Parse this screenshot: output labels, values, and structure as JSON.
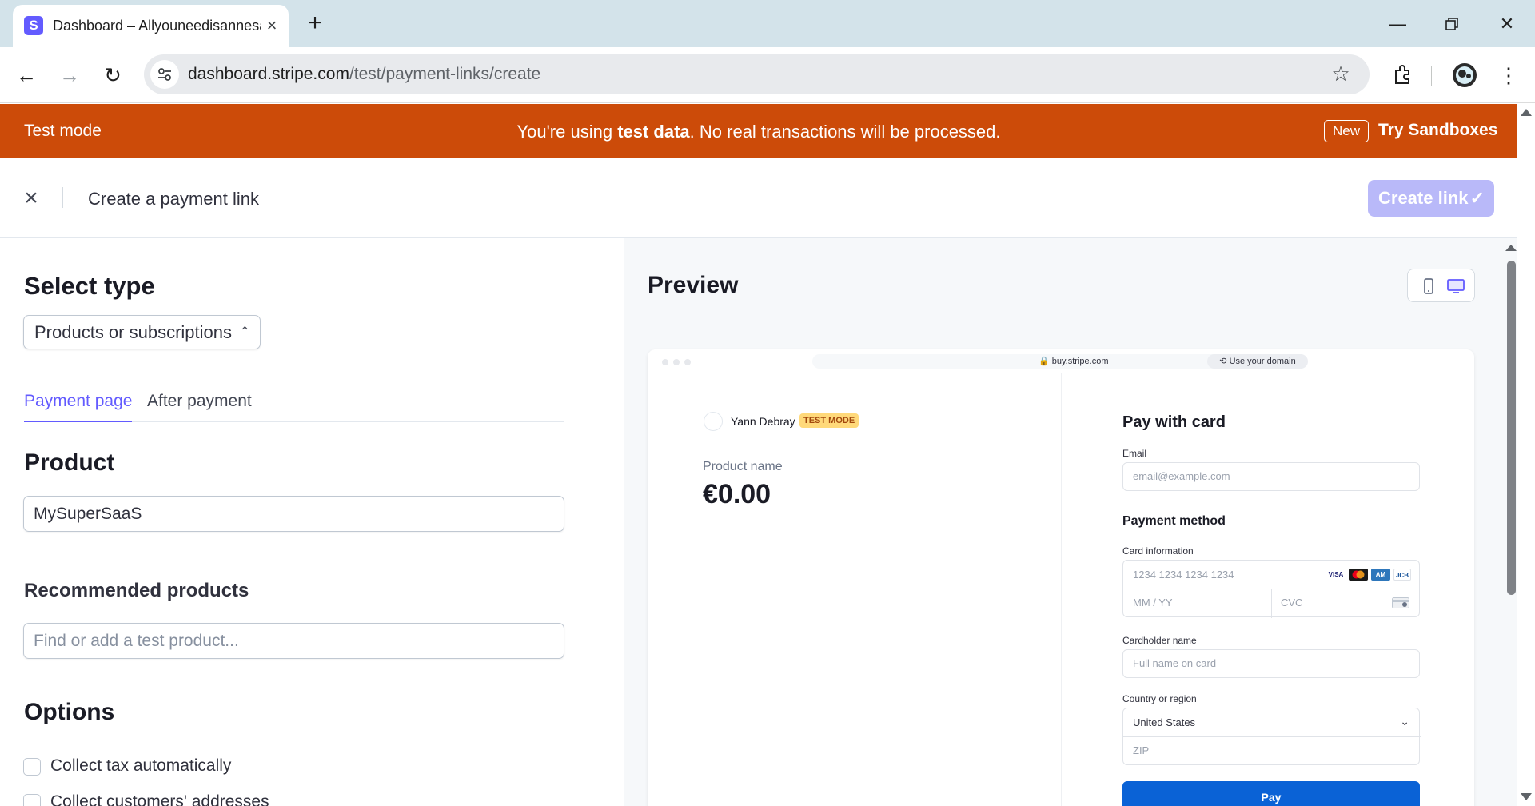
{
  "browser": {
    "tab_title": "Dashboard – Allyouneedisannesalvetti",
    "tab_favicon_letter": "S",
    "url_host": "dashboard.stripe.com",
    "url_path": "/test/payment-links/create"
  },
  "banner": {
    "left": "Test mode",
    "message_pre": "You're using ",
    "message_bold": "test data",
    "message_post": ". No real transactions will be processed.",
    "new_badge": "New",
    "try_link": "Try Sandboxes"
  },
  "header": {
    "title": "Create a payment link",
    "create_button": "Create link"
  },
  "left": {
    "select_type_heading": "Select type",
    "type_value": "Products or subscriptions",
    "tabs": [
      {
        "label": "Payment page",
        "active": true
      },
      {
        "label": "After payment",
        "active": false
      }
    ],
    "product_heading": "Product",
    "product_value": "MySuperSaaS",
    "recommended_heading": "Recommended products",
    "recommended_placeholder": "Find or add a test product...",
    "options_heading": "Options",
    "options": [
      {
        "label": "Collect tax automatically",
        "checked": false
      },
      {
        "label": "Collect customers' addresses",
        "checked": false
      }
    ]
  },
  "preview": {
    "heading": "Preview",
    "fake_url": "buy.stripe.com",
    "use_domain": "Use your domain",
    "merchant": "Yann Debray",
    "test_badge": "TEST MODE",
    "product_name": "Product name",
    "price": "€0.00",
    "pay_heading": "Pay with card",
    "email_label": "Email",
    "email_placeholder": "email@example.com",
    "payment_method_heading": "Payment method",
    "card_info_label": "Card information",
    "card_number_placeholder": "1234 1234 1234 1234",
    "expiry_placeholder": "MM / YY",
    "cvc_placeholder": "CVC",
    "card_brands": [
      "VISA",
      "mastercard",
      "amex",
      "JCB"
    ],
    "cardholder_label": "Cardholder name",
    "cardholder_placeholder": "Full name on card",
    "country_label": "Country or region",
    "country_value": "United States",
    "zip_placeholder": "ZIP",
    "pay_button": "Pay"
  },
  "colors": {
    "banner": "#cc4b09",
    "accent": "#635bff",
    "create_button_disabled": "#b9b9f9",
    "pay_button": "#0a62d6"
  }
}
